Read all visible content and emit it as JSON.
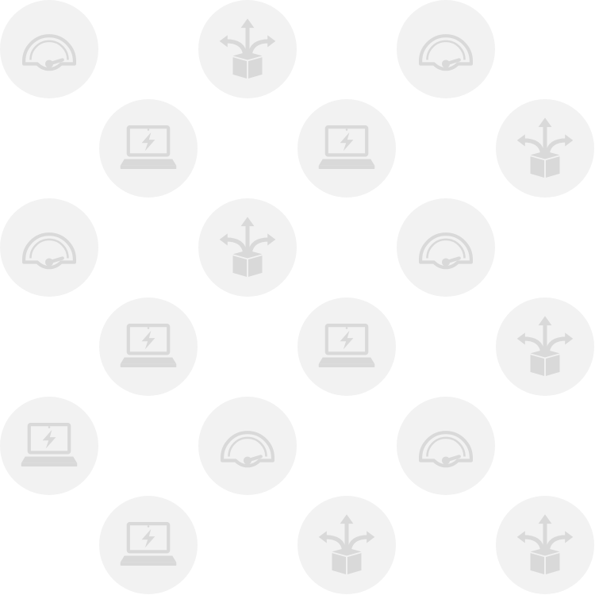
{
  "colors": {
    "background": "#ffffff",
    "tile": "#f2f2f2",
    "icon": "#d9d9d9",
    "icon_accent": "#f2f2f2"
  },
  "tiles": [
    {
      "icon": "gauge-icon"
    },
    {
      "icon": "branching-arrows-box-icon"
    },
    {
      "icon": "gauge-icon"
    },
    {
      "icon": "laptop-power-icon"
    },
    {
      "icon": "laptop-power-icon"
    },
    {
      "icon": "branching-arrows-box-icon"
    },
    {
      "icon": "gauge-icon"
    },
    {
      "icon": "branching-arrows-box-icon"
    },
    {
      "icon": "gauge-icon"
    },
    {
      "icon": "laptop-power-icon"
    },
    {
      "icon": "laptop-power-icon"
    },
    {
      "icon": "branching-arrows-box-icon"
    },
    {
      "icon": "laptop-power-icon"
    },
    {
      "icon": "gauge-icon"
    },
    {
      "icon": "gauge-icon"
    },
    {
      "icon": "laptop-power-icon"
    },
    {
      "icon": "branching-arrows-box-icon"
    },
    {
      "icon": "branching-arrows-box-icon"
    }
  ]
}
